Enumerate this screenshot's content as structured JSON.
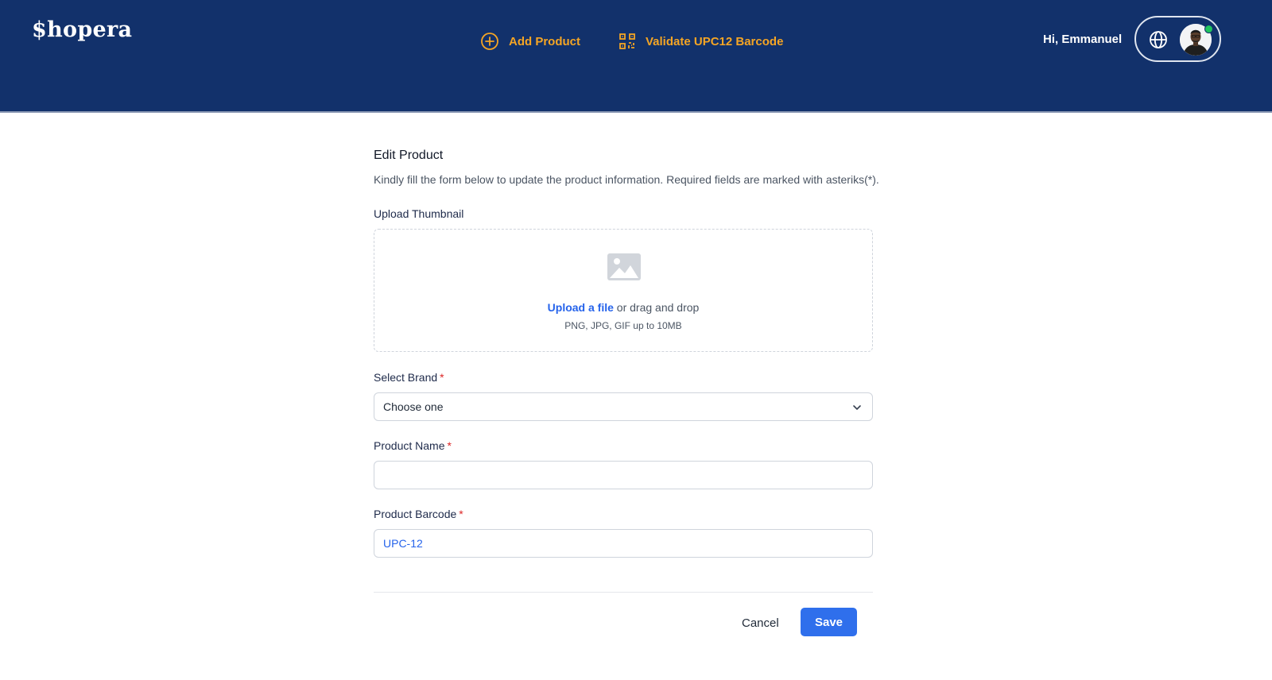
{
  "header": {
    "logo": "$hopera",
    "nav": [
      {
        "label": "Add Product",
        "icon": "plus-circle-icon"
      },
      {
        "label": "Validate UPC12 Barcode",
        "icon": "qr-code-icon"
      }
    ],
    "greeting": "Hi, Emmanuel",
    "status": "online"
  },
  "form": {
    "title": "Edit Product",
    "subtitle": "Kindly fill the form below to update the product information. Required fields are marked with asteriks(*).",
    "thumbnail": {
      "label": "Upload Thumbnail",
      "link_text": "Upload a file",
      "drag_text": " or drag and drop",
      "hint": "PNG, JPG, GIF up to 10MB"
    },
    "brand": {
      "label": "Select Brand",
      "required_mark": "*",
      "value": "Choose one"
    },
    "name": {
      "label": "Product Name",
      "required_mark": "*",
      "value": ""
    },
    "barcode": {
      "label": "Product Barcode",
      "required_mark": "*",
      "value": "UPC-12"
    },
    "actions": {
      "cancel": "Cancel",
      "save": "Save"
    }
  },
  "colors": {
    "header_bg": "#12316b",
    "accent": "#f5a524",
    "primary": "#2f6fec",
    "link": "#2563eb",
    "required": "#dc2626",
    "online": "#22c55e"
  }
}
